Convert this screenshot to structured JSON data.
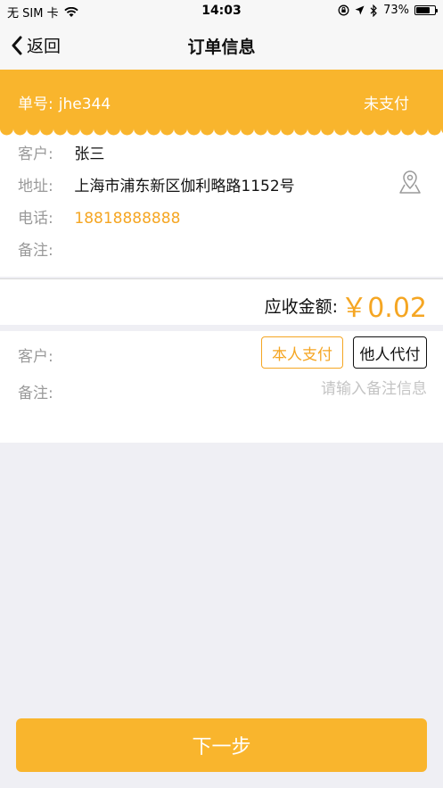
{
  "status_bar": {
    "carrier": "无 SIM 卡",
    "time": "14:03",
    "battery": "73%",
    "battery_level": 0.73
  },
  "nav": {
    "back_label": "返回",
    "title": "订单信息"
  },
  "order": {
    "number_label": "单号:",
    "number": "jhe344",
    "status": "未支付"
  },
  "info": {
    "customer_label": "客户:",
    "customer": "张三",
    "address_label": "地址:",
    "address": "上海市浦东新区伽利略路1152号",
    "phone_label": "电话:",
    "phone": "18818888888",
    "remark_label": "备注:",
    "remark": ""
  },
  "amount": {
    "label": "应收金额:",
    "value": "￥0.02"
  },
  "payment": {
    "customer_label": "客户:",
    "self_pay": "本人支付",
    "other_pay": "他人代付",
    "remark_label": "备注:",
    "remark_placeholder": "请输入备注信息",
    "remark_value": ""
  },
  "next_button": "下一步",
  "colors": {
    "accent": "#f9b52d",
    "accent_text": "#f5a623"
  }
}
